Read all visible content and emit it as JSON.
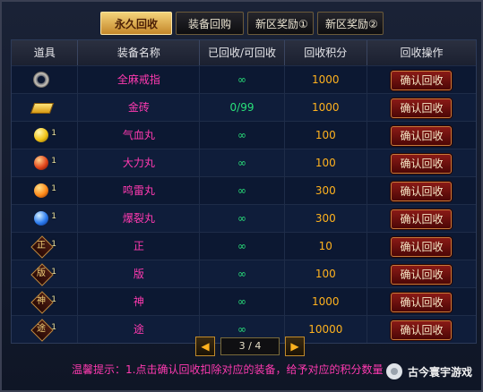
{
  "tabs": [
    {
      "label": "永久回收",
      "active": true
    },
    {
      "label": "装备回购",
      "active": false
    },
    {
      "label": "新区奖励①",
      "active": false
    },
    {
      "label": "新区奖励②",
      "active": false
    }
  ],
  "table": {
    "headers": [
      "道具",
      "装备名称",
      "已回收/可回收",
      "回收积分",
      "回收操作"
    ],
    "rows": [
      {
        "icon": "ring-icon",
        "count": "",
        "name": "全麻戒指",
        "qty": "∞",
        "points": "1000",
        "action": "确认回收"
      },
      {
        "icon": "gold-brick-icon",
        "count": "",
        "name": "金砖",
        "qty": "0/99",
        "points": "1000",
        "action": "确认回收"
      },
      {
        "icon": "yellow-pill-icon",
        "count": "1",
        "name": "气血丸",
        "qty": "∞",
        "points": "100",
        "action": "确认回收"
      },
      {
        "icon": "red-pill-icon",
        "count": "1",
        "name": "大力丸",
        "qty": "∞",
        "points": "100",
        "action": "确认回收"
      },
      {
        "icon": "fire-pill-icon",
        "count": "1",
        "name": "鸣雷丸",
        "qty": "∞",
        "points": "300",
        "action": "确认回收"
      },
      {
        "icon": "blue-pill-icon",
        "count": "1",
        "name": "爆裂丸",
        "qty": "∞",
        "points": "300",
        "action": "确认回收"
      },
      {
        "icon": "token-zheng-icon",
        "glyph": "正",
        "count": "1",
        "name": "正",
        "qty": "∞",
        "points": "10",
        "action": "确认回收"
      },
      {
        "icon": "token-ban-icon",
        "glyph": "版",
        "count": "1",
        "name": "版",
        "qty": "∞",
        "points": "100",
        "action": "确认回收"
      },
      {
        "icon": "token-shen-icon",
        "glyph": "神",
        "count": "1",
        "name": "神",
        "qty": "∞",
        "points": "1000",
        "action": "确认回收"
      },
      {
        "icon": "token-tu-icon",
        "glyph": "途",
        "count": "1",
        "name": "途",
        "qty": "∞",
        "points": "10000",
        "action": "确认回收"
      }
    ]
  },
  "pager": {
    "prev": "◀",
    "next": "▶",
    "text": "3 / 4"
  },
  "tip": {
    "label": "温馨提示：",
    "text": "1.点击确认回收扣除对应的装备，给予对应的积分数量"
  },
  "watermark": "古今寰宇游戏"
}
